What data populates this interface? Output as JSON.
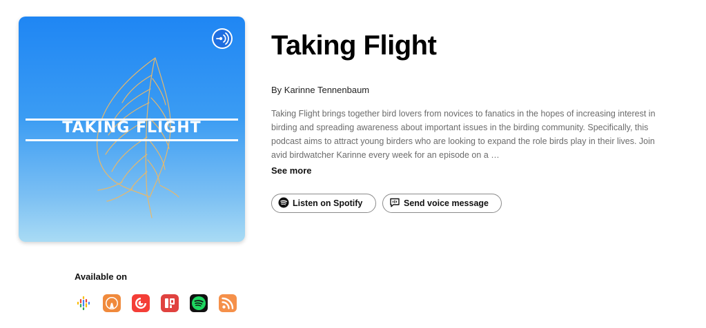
{
  "podcast": {
    "cover_text": "TAKING FLIGHT",
    "title": "Taking Flight",
    "author": "By Karinne Tennenbaum",
    "description": "Taking Flight brings together bird lovers from novices to fanatics in the hopes of increasing interest in birding and spreading awareness about important issues in the birding community. Specifically, this podcast aims to attract young birders who are looking to expand the role birds play in their lives. Join avid birdwatcher Karinne every week for an episode on a …",
    "see_more": "See more"
  },
  "actions": {
    "listen_label": "Listen on Spotify",
    "voice_label": "Send voice message"
  },
  "available": {
    "label": "Available on",
    "platforms": [
      {
        "icon": "google-podcasts-icon",
        "color": "#4285f4"
      },
      {
        "icon": "overcast-icon",
        "color": "#f08a3c"
      },
      {
        "icon": "pocket-casts-icon",
        "color": "#f43e37"
      },
      {
        "icon": "radiopublic-icon",
        "color": "#e0423f"
      },
      {
        "icon": "spotify-icon",
        "color": "#1ed760"
      },
      {
        "icon": "rss-icon",
        "color": "#f5904a"
      }
    ]
  },
  "colors": {
    "cover_blue_top": "#1f86f3",
    "cover_blue_bottom": "#a9dbf4",
    "feather_gold": "#e8b86a",
    "text_primary": "#111111",
    "text_secondary": "#6b6b6b"
  }
}
